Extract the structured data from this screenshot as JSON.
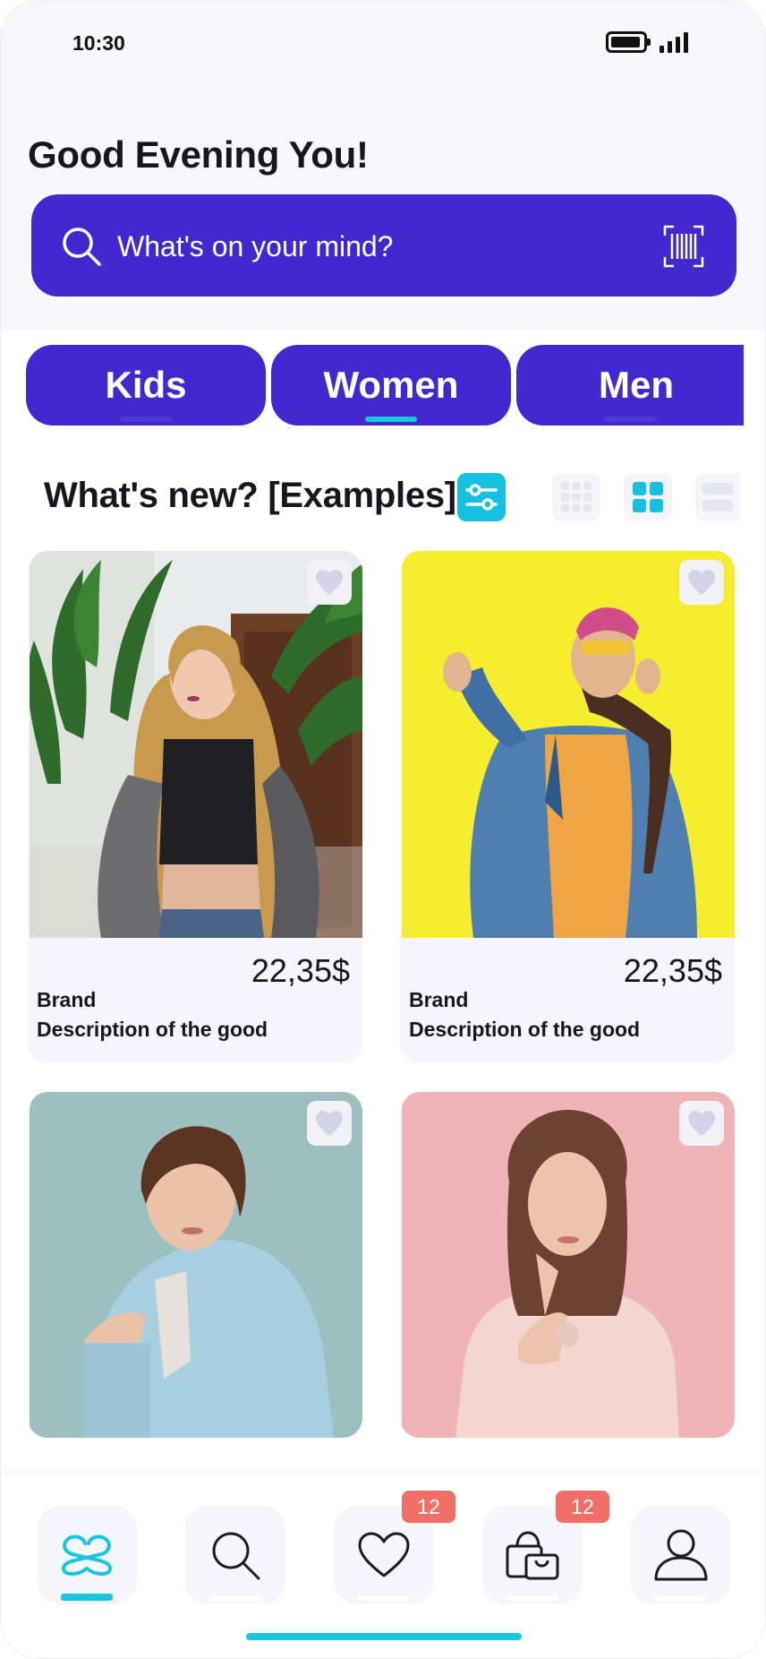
{
  "status_bar": {
    "time": "10:30",
    "battery_icon": "battery-icon",
    "signal_icon": "signal-icon"
  },
  "header": {
    "greeting": "Good Evening You!"
  },
  "search": {
    "placeholder": "What's on your mind?",
    "search_icon": "search-icon",
    "scan_icon": "barcode-scan-icon"
  },
  "categories": [
    {
      "label": "Kids",
      "active": false
    },
    {
      "label": "Women",
      "active": true
    },
    {
      "label": "Men",
      "active": false
    }
  ],
  "section": {
    "title": "What's new? [Examples]",
    "filter_icon": "sliders-icon",
    "view_modes": [
      "grid-3x3-icon",
      "grid-2x2-icon",
      "list-icon"
    ],
    "active_view": "grid-2x2-icon"
  },
  "products": [
    {
      "price": "22,35$",
      "brand": "Brand",
      "description": "Description of the good",
      "photo": "woman-plants"
    },
    {
      "price": "22,35$",
      "brand": "Brand",
      "description": "Description of the good",
      "photo": "woman-yellow"
    },
    {
      "price": "",
      "brand": "",
      "description": "",
      "photo": "woman-blue-blazer"
    },
    {
      "price": "",
      "brand": "",
      "description": "",
      "photo": "woman-pink"
    }
  ],
  "bottom_nav": {
    "items": [
      {
        "icon": "home-logo-icon",
        "active": true,
        "badge": ""
      },
      {
        "icon": "search-icon",
        "active": false,
        "badge": ""
      },
      {
        "icon": "heart-icon",
        "active": false,
        "badge": "12"
      },
      {
        "icon": "shopping-bag-icon",
        "active": false,
        "badge": "12"
      },
      {
        "icon": "profile-icon",
        "active": false,
        "badge": ""
      }
    ]
  },
  "colors": {
    "primary": "#4328cf",
    "accent": "#17c6e0",
    "badge": "#f26f68",
    "background": "#f8f7fc"
  }
}
